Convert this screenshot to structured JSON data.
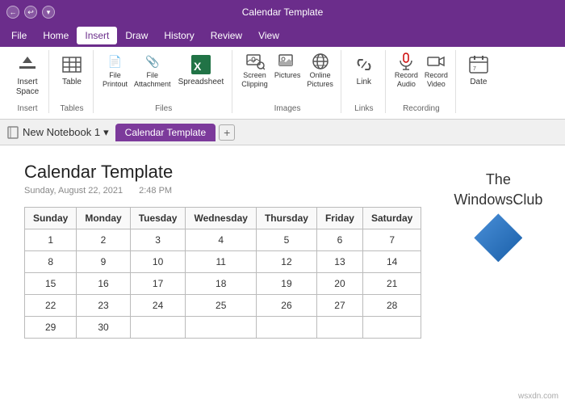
{
  "titleBar": {
    "title": "Calendar Template",
    "backBtn": "←",
    "undoBtn": "↩",
    "pinBtn": "▾"
  },
  "menuBar": {
    "items": [
      "File",
      "Home",
      "Insert",
      "Draw",
      "History",
      "Review",
      "View"
    ],
    "activeItem": "Insert"
  },
  "ribbon": {
    "groups": [
      {
        "label": "Insert",
        "buttons": [
          {
            "id": "insert-space",
            "icon": "⬆",
            "label": "Insert\nSpace"
          }
        ]
      },
      {
        "label": "Tables",
        "buttons": [
          {
            "id": "table",
            "icon": "⊞",
            "label": "Table"
          }
        ]
      },
      {
        "label": "Files",
        "buttons": [
          {
            "id": "file-printout",
            "icon": "📄",
            "label": "File\nPrintout"
          },
          {
            "id": "file-attachment",
            "icon": "📎",
            "label": "File\nAttachment"
          },
          {
            "id": "spreadsheet",
            "icon": "📊",
            "label": "Spreadsheet"
          }
        ]
      },
      {
        "label": "Images",
        "buttons": [
          {
            "id": "screen-clipping",
            "icon": "📷",
            "label": "Screen\nClipping"
          },
          {
            "id": "pictures",
            "icon": "🖼",
            "label": "Pictures"
          },
          {
            "id": "online-pictures",
            "icon": "🌐",
            "label": "Online\nPictures"
          }
        ]
      },
      {
        "label": "Links",
        "buttons": [
          {
            "id": "link",
            "icon": "🔗",
            "label": "Link"
          }
        ]
      },
      {
        "label": "Recording",
        "buttons": [
          {
            "id": "record-audio",
            "icon": "🎙",
            "label": "Record\nAudio"
          },
          {
            "id": "record-video",
            "icon": "🎬",
            "label": "Record\nVideo"
          }
        ]
      },
      {
        "label": "",
        "buttons": [
          {
            "id": "date",
            "icon": "📅",
            "label": "Date"
          }
        ]
      }
    ]
  },
  "notebook": {
    "name": "New Notebook 1",
    "dropdownIcon": "▾",
    "activeTab": "Calendar Template",
    "addTabIcon": "+"
  },
  "page": {
    "title": "Calendar Template",
    "date": "Sunday, August 22, 2021",
    "time": "2:48 PM"
  },
  "logo": {
    "line1": "The",
    "line2": "WindowsClub"
  },
  "calendar": {
    "headers": [
      "Sunday",
      "Monday",
      "Tuesday",
      "Wednesday",
      "Thursday",
      "Friday",
      "Saturday"
    ],
    "rows": [
      [
        "1",
        "2",
        "3",
        "4",
        "5",
        "6",
        "7"
      ],
      [
        "8",
        "9",
        "10",
        "11",
        "12",
        "13",
        "14"
      ],
      [
        "15",
        "16",
        "17",
        "18",
        "19",
        "20",
        "21"
      ],
      [
        "22",
        "23",
        "24",
        "25",
        "26",
        "27",
        "28"
      ],
      [
        "29",
        "30",
        "",
        "",
        "",
        "",
        ""
      ]
    ]
  },
  "watermark": "wsxdn.com"
}
